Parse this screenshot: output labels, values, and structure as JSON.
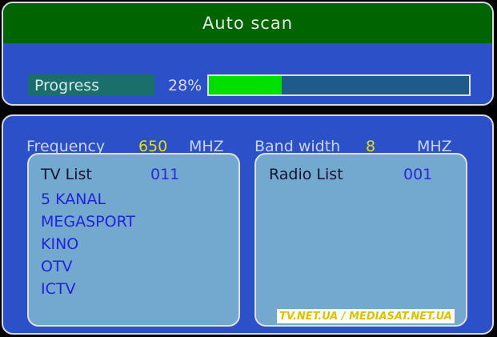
{
  "title": "Auto scan",
  "progress": {
    "label": "Progress",
    "percent_text": "28%",
    "fraction": 0.28,
    "fill_color": "#00e000"
  },
  "scan_info": {
    "frequency_label": "Frequency",
    "frequency_value": "650",
    "frequency_unit": "MHZ",
    "bandwidth_label": "Band width",
    "bandwidth_value": "8",
    "bandwidth_unit": "MHZ"
  },
  "tv_list": {
    "label": "TV List",
    "count": "011",
    "channels": [
      "5 KANAL",
      "MEGASPORT",
      "KINO",
      "OTV",
      "ICTV"
    ]
  },
  "radio_list": {
    "label": "Radio List",
    "count": "001",
    "channels": []
  },
  "watermark": "TV.NET.UA / MEDIASAT.NET.UA",
  "colors": {
    "panel_bg": "#2b50c8",
    "title_bg": "#006400",
    "list_bg": "#73a8cf",
    "highlight_value": "#e8e000"
  }
}
